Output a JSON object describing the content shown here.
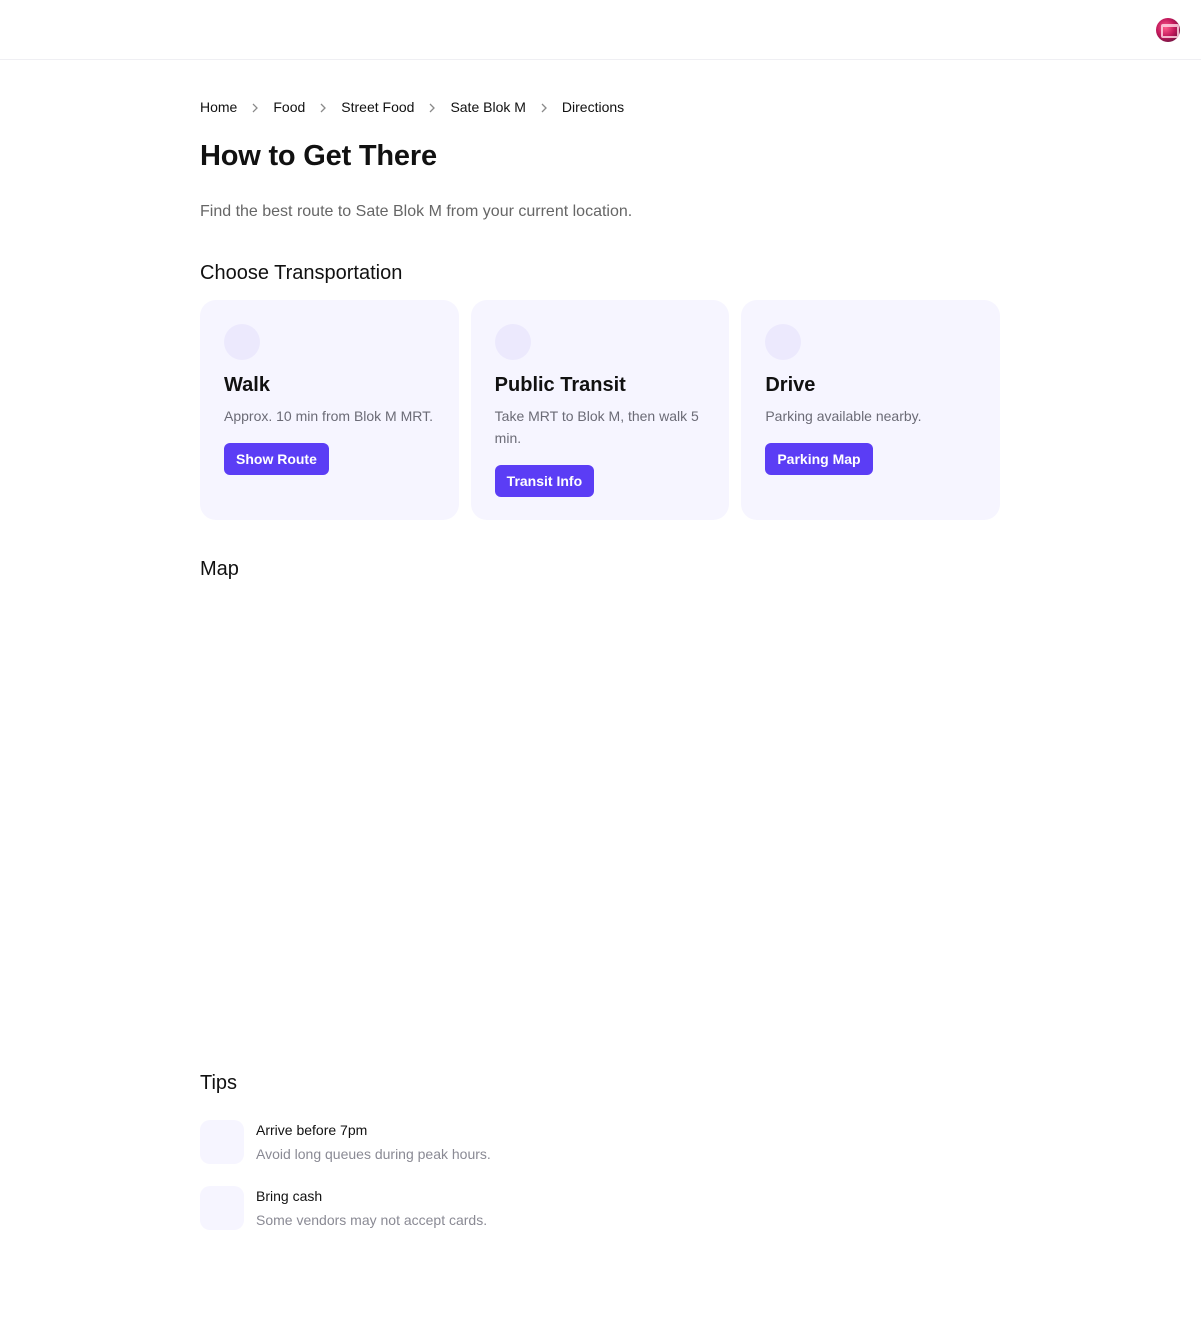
{
  "breadcrumb": {
    "items": [
      {
        "label": "Home"
      },
      {
        "label": "Food"
      },
      {
        "label": "Street Food"
      },
      {
        "label": "Sate Blok M"
      },
      {
        "label": "Directions"
      }
    ]
  },
  "header": {
    "title": "How to Get There",
    "subtitle": "Find the best route to Sate Blok M from your current location."
  },
  "transport": {
    "heading": "Choose Transportation",
    "cards": [
      {
        "title": "Walk",
        "desc": "Approx. 10 min from Blok M MRT.",
        "button": "Show Route"
      },
      {
        "title": "Public Transit",
        "desc": "Take MRT to Blok M, then walk 5 min.",
        "button": "Transit Info"
      },
      {
        "title": "Drive",
        "desc": "Parking available nearby.",
        "button": "Parking Map"
      }
    ]
  },
  "map": {
    "heading": "Map"
  },
  "tips": {
    "heading": "Tips",
    "items": [
      {
        "title": "Arrive before 7pm",
        "desc": "Avoid long queues during peak hours."
      },
      {
        "title": "Bring cash",
        "desc": "Some vendors may not accept cards."
      }
    ]
  },
  "colors": {
    "accent": "#5b3df5",
    "card_bg": "#f6f5ff"
  }
}
